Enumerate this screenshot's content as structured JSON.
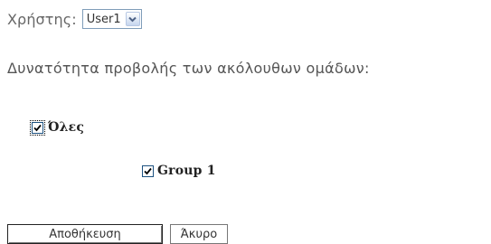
{
  "user": {
    "label": "Χρήστης:",
    "selected_value": "User1"
  },
  "description": "Δυνατότητα προβολής των ακόλουθων ομάδων:",
  "groups": [
    {
      "label": "Όλες",
      "checked": true
    },
    {
      "label": "Group 1",
      "checked": true
    }
  ],
  "buttons": {
    "save_label": "Αποθήκευση",
    "cancel_label": "Άκυρο"
  },
  "colors": {
    "text": "#333333",
    "label_text": "#666666",
    "select_border": "#7f9db9",
    "checkbox_border": "#1c5180"
  },
  "icons": {
    "dropdown": "chevron-down-icon",
    "check": "checkmark-icon"
  }
}
